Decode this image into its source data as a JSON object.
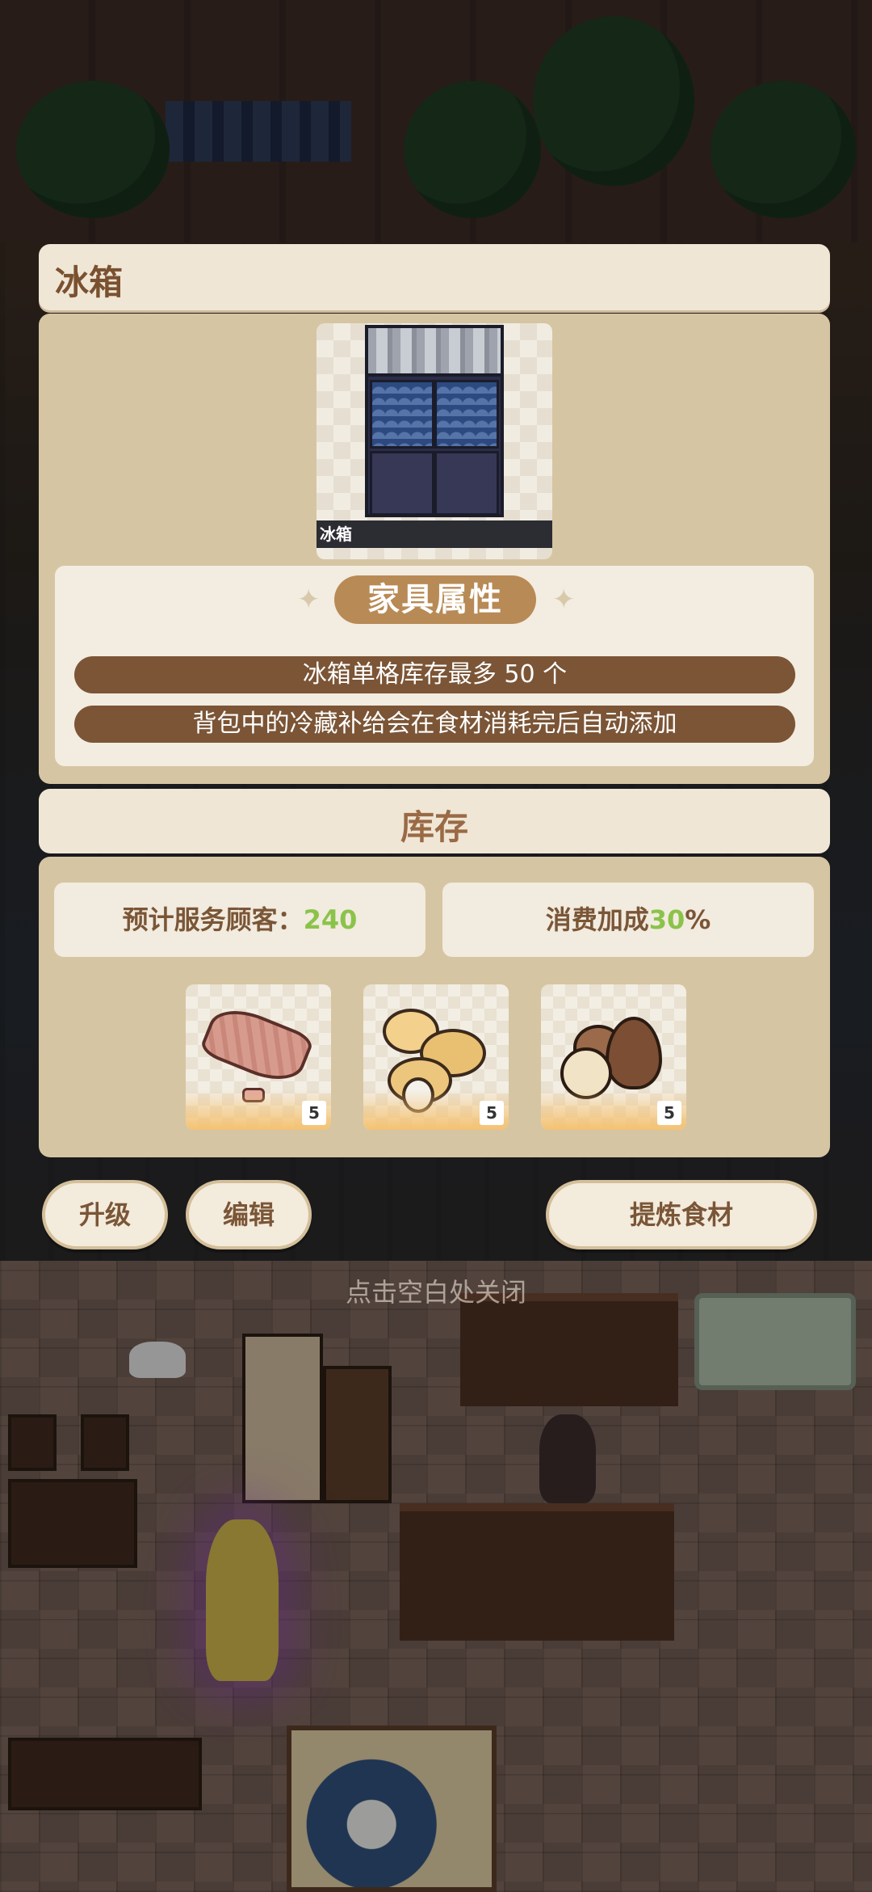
{
  "dialog": {
    "title": "冰箱",
    "item_card": {
      "name": "冰箱"
    },
    "attributes": {
      "title": "家具属性",
      "lines": [
        "冰箱单格库存最多 50 个",
        "背包中的冷藏补给会在食材消耗完后自动添加"
      ]
    },
    "stock": {
      "title": "库存",
      "served_label": "预计服务顾客：",
      "served_value": "240",
      "bonus_label": "消费加成",
      "bonus_value": "30",
      "bonus_suffix": "%",
      "items": [
        {
          "icon": "meat-icon",
          "count": "5"
        },
        {
          "icon": "eggs-icon",
          "count": "5"
        },
        {
          "icon": "chestnut-icon",
          "count": "5"
        }
      ]
    },
    "buttons": {
      "upgrade": "升级",
      "edit": "编辑",
      "refine": "提炼食材"
    },
    "close_hint": "点击空白处关闭"
  },
  "colors": {
    "accent_brown": "#7b5536",
    "highlight_green": "#8bc34a",
    "panel_bg": "#d6c5a3"
  }
}
